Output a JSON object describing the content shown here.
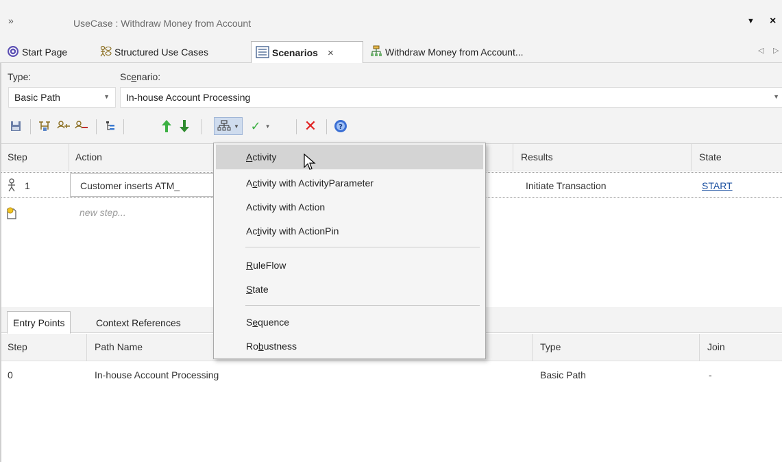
{
  "window": {
    "title": "UseCase : Withdraw Money from Account",
    "expand_icon": "double-chevron-right-icon",
    "pin_icon": "dropdown-triangle-icon",
    "close_icon": "close-icon"
  },
  "doc_tabs": [
    {
      "label": "Start Page",
      "icon": "start-page-icon"
    },
    {
      "label": "Structured Use Cases",
      "icon": "use-case-icon"
    },
    {
      "label": "Scenarios",
      "icon": "scenarios-icon",
      "active": true
    },
    {
      "label": "Withdraw Money from Account...",
      "icon": "diagram-icon"
    }
  ],
  "filters": {
    "type_label": "Type:",
    "scenario_label_pre": "Sc",
    "scenario_label_u": "e",
    "scenario_label_post": "nario:",
    "type_value": "Basic Path",
    "scenario_value": "In-house Account Processing"
  },
  "toolbar_icons": [
    "save-icon",
    "structure-icon",
    "add-actor-icon",
    "add-system-icon",
    "indent-icon",
    "move-up-icon",
    "move-down-icon",
    "generate-diagram-icon",
    "validate-icon",
    "delete-icon",
    "help-icon"
  ],
  "steps_table": {
    "headers": {
      "step": "Step",
      "action": "Action",
      "results": "Results",
      "state": "State"
    },
    "rows": [
      {
        "step": "1",
        "action": "Customer inserts ATM_",
        "results": "Initiate Transaction",
        "state": "START"
      }
    ],
    "new_step_placeholder": "new step..."
  },
  "bottom_tabs": {
    "entry_points": "Entry Points",
    "context_references": "Context References"
  },
  "entry_table": {
    "headers": {
      "step": "Step",
      "path_name": "Path Name",
      "type": "Type",
      "join": "Join"
    },
    "rows": [
      {
        "step": "0",
        "path_name": "In-house Account Processing",
        "type": "Basic Path",
        "join": "-"
      }
    ]
  },
  "menu": {
    "items": [
      {
        "pre": "",
        "u": "A",
        "post": "ctivity"
      },
      {
        "pre": "A",
        "u": "c",
        "post": "tivity with ActivityParameter"
      },
      {
        "pre": "Activity with Action",
        "u": "",
        "post": ""
      },
      {
        "pre": "Ac",
        "u": "t",
        "post": "ivity with ActionPin"
      },
      {
        "pre": "",
        "u": "R",
        "post": "uleFlow"
      },
      {
        "pre": "",
        "u": "S",
        "post": "tate"
      },
      {
        "pre": "S",
        "u": "e",
        "post": "quence"
      },
      {
        "pre": "Ro",
        "u": "b",
        "post": "ustness"
      }
    ]
  },
  "colors": {
    "panel_bg": "#f3f3f3",
    "menu_highlight": "#d4d4d4",
    "link_state": "#1a4fa0",
    "up_arrow": "#3cb043",
    "down_arrow": "#2e8b2e",
    "delete_x": "#e02020",
    "help": "#3b6fd4"
  }
}
